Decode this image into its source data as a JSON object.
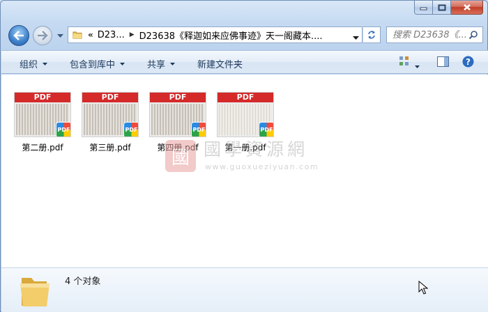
{
  "window": {
    "caption_buttons": [
      "minimize",
      "maximize",
      "close"
    ]
  },
  "address_bar": {
    "overflow_marker": "«",
    "crumbs": [
      "D23...",
      "D23638《释迦如来应佛事迹》天一阁藏本...."
    ]
  },
  "search": {
    "placeholder": "搜索 D23638《..."
  },
  "toolbar": {
    "organize": "组织",
    "include_in_library": "包含到库中",
    "share": "共享",
    "new_folder": "新建文件夹"
  },
  "files": [
    {
      "name": "第二册.pdf",
      "thumb_label": "PDF",
      "badge": "PDF"
    },
    {
      "name": "第三册.pdf",
      "thumb_label": "PDF",
      "badge": "PDF"
    },
    {
      "name": "第四册.pdf",
      "thumb_label": "PDF",
      "badge": "PDF"
    },
    {
      "name": "第一册.pdf",
      "thumb_label": "PDF",
      "badge": "PDF"
    }
  ],
  "watermark": {
    "seal_char": "國",
    "title": "國學資源網",
    "url": "www.guoxueziyuan.com"
  },
  "status": {
    "count_text": "4 个对象"
  },
  "colors": {
    "pdf_band": "#d42a2a",
    "accent": "#1e395b"
  }
}
